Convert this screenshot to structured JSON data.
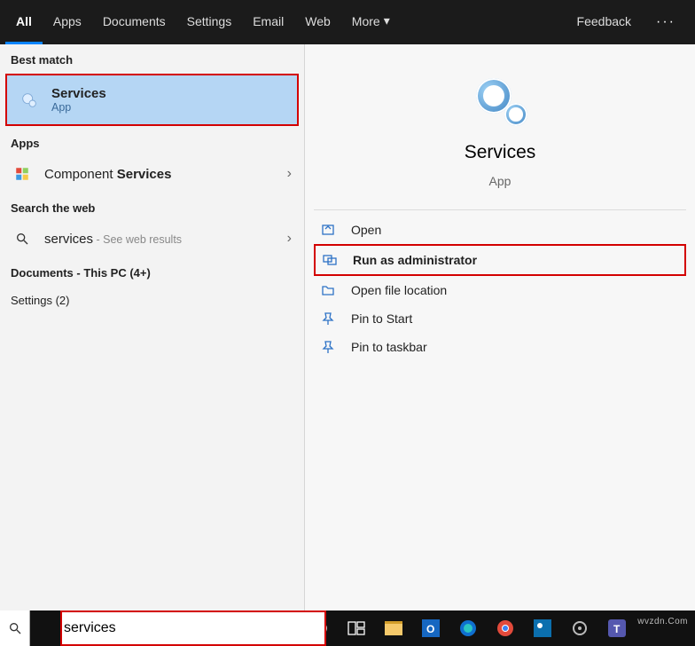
{
  "tabs": {
    "all": "All",
    "apps": "Apps",
    "documents": "Documents",
    "settings": "Settings",
    "email": "Email",
    "web": "Web",
    "more": "More",
    "feedback": "Feedback"
  },
  "left": {
    "best_match_label": "Best match",
    "best": {
      "title": "Services",
      "subtitle": "App"
    },
    "apps_label": "Apps",
    "component_prefix": "Component ",
    "component_bold": "Services",
    "searchweb_label": "Search the web",
    "web": {
      "term": "services",
      "suffix": " - See web results"
    },
    "docs_label": "Documents - This PC (4+)",
    "settings_label": "Settings (2)"
  },
  "right": {
    "title": "Services",
    "subtitle": "App",
    "actions": {
      "open": "Open",
      "run_admin": "Run as administrator",
      "open_loc": "Open file location",
      "pin_start": "Pin to Start",
      "pin_taskbar": "Pin to taskbar"
    }
  },
  "search": {
    "value": "services"
  },
  "watermark": "wvzdn.Com"
}
